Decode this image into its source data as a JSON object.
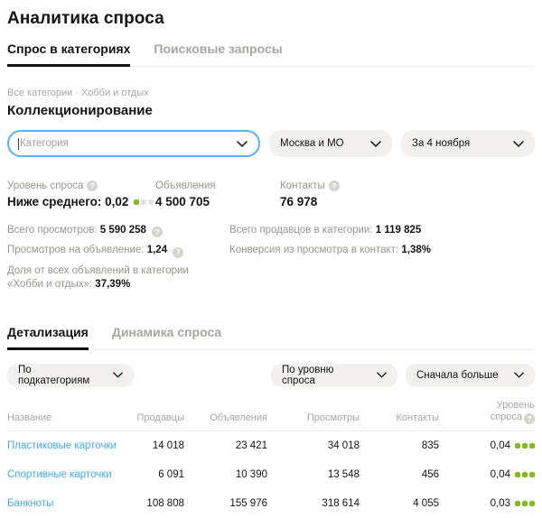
{
  "colors": {
    "accent": "#55b1f0",
    "link": "#42aaf0",
    "green": "#84b81f",
    "dot-off": "#e4e2df"
  },
  "icons": {
    "help": "?"
  },
  "header": {
    "title": "Аналитика спроса"
  },
  "top_tabs": {
    "categories": "Спрос в категориях",
    "queries": "Поисковые запросы"
  },
  "breadcrumb": "Все категории · Хобби и отдых",
  "category_title": "Коллекционирование",
  "filters": {
    "category_placeholder": "Категория",
    "region": "Москва и МО",
    "period": "За 4 ноября"
  },
  "summary": {
    "demand_label": "Уровень спроса",
    "demand_value": "Ниже среднего: 0,02",
    "demand_dots_on": 1,
    "ads_label": "Объявления",
    "ads_value": "4 500 705",
    "contacts_label": "Контакты",
    "contacts_value": "76 978"
  },
  "stats": {
    "left": [
      {
        "label": "Всего просмотров:",
        "value": "5 590 258"
      },
      {
        "label": "Просмотров на объявление:",
        "value": "1,24"
      },
      {
        "label": "Доля от всех объявлений в категории «Хобби и отдых»:",
        "value": "37,39%"
      }
    ],
    "right": [
      {
        "label": "Всего продавцов в категории:",
        "value": "1 119 825"
      },
      {
        "label": "Конверсия из просмотра в контакт:",
        "value": "1,38%"
      }
    ]
  },
  "section_tabs": {
    "details": "Детализация",
    "dynamics": "Динамика спроса"
  },
  "table_filters": {
    "group": "По подкатегориям",
    "metric": "По уровню спроса",
    "order": "Сначала больше"
  },
  "table": {
    "headers": {
      "name": "Название",
      "sellers": "Продавцы",
      "ads": "Объявления",
      "views": "Просмотры",
      "contacts": "Контакты",
      "demand": "Уровень спроса"
    },
    "rows": [
      {
        "name": "Пластиковые карточки",
        "sellers": "14 018",
        "ads": "23 421",
        "views": "34 018",
        "contacts": "835",
        "demand": "0,04",
        "dots_on": 3
      },
      {
        "name": "Спортивные карточки",
        "sellers": "6 091",
        "ads": "10 390",
        "views": "13 548",
        "contacts": "456",
        "demand": "0,04",
        "dots_on": 3
      },
      {
        "name": "Банкноты",
        "sellers": "108 808",
        "ads": "155 976",
        "views": "318 614",
        "contacts": "4 055",
        "demand": "0,03",
        "dots_on": 3
      }
    ]
  }
}
